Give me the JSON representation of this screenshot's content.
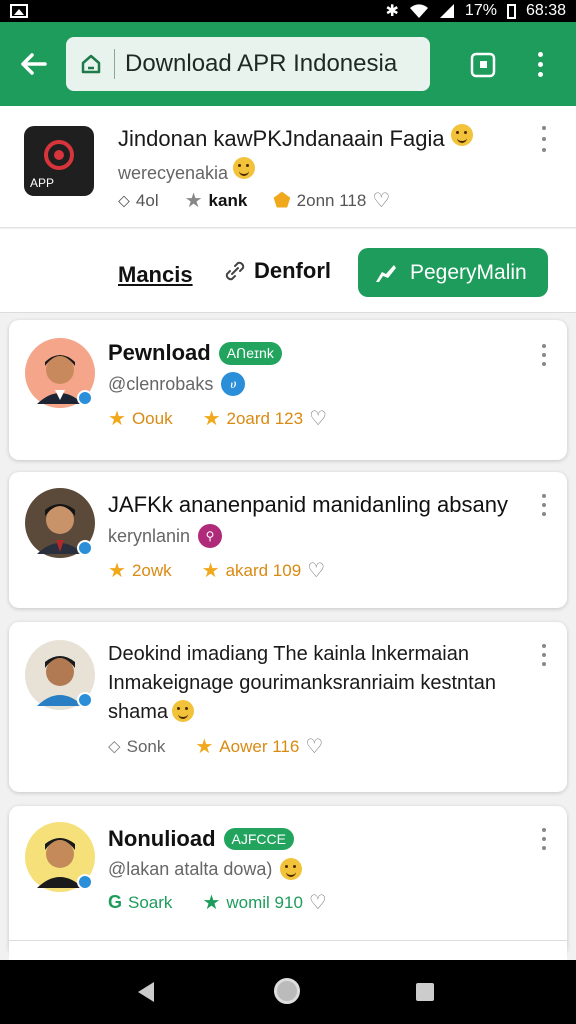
{
  "status_bar": {
    "battery": "17%",
    "time": "68:38"
  },
  "toolbar": {
    "url_title": "Download APR Indonesia"
  },
  "app": {
    "icon_label": "APP",
    "title": "Jindonan kawPKJndanaain Fagia",
    "subtitle": "werecyenakia",
    "stat1": "4ol",
    "stat2": "kank",
    "stat3": "2onn 118"
  },
  "actions": {
    "tab1": "Mancis",
    "tab2": "Denforl",
    "primary": "PegeryMalin"
  },
  "cards": [
    {
      "name": "Pewnload",
      "badge": "Aᑎeɪnk",
      "handle": "@clenrobaks",
      "handle_icon": "ሀ",
      "stat1": "Oouk",
      "stat2": "2oard 123"
    },
    {
      "name": "JAFKk ananenpanid manidanling absany",
      "handle": "kerynlanin",
      "stat1": "2owk",
      "stat2": "akard 109"
    },
    {
      "line1": "Deokind imadiang The kainla lnkermaian",
      "line2": "Inmakeignage gourimanksranriaim kestntan",
      "line3": "shama",
      "stat1": "Sonk",
      "stat2": "Aower 116"
    },
    {
      "name": "Nonulioad",
      "badge": "AJFCCE",
      "handle": "@lakan atalta dowa)",
      "stat1": "Soark",
      "stat2": "womil 910"
    }
  ],
  "colors": {
    "brand_green": "#1e9c5c",
    "star_orange": "#f0a81c"
  }
}
